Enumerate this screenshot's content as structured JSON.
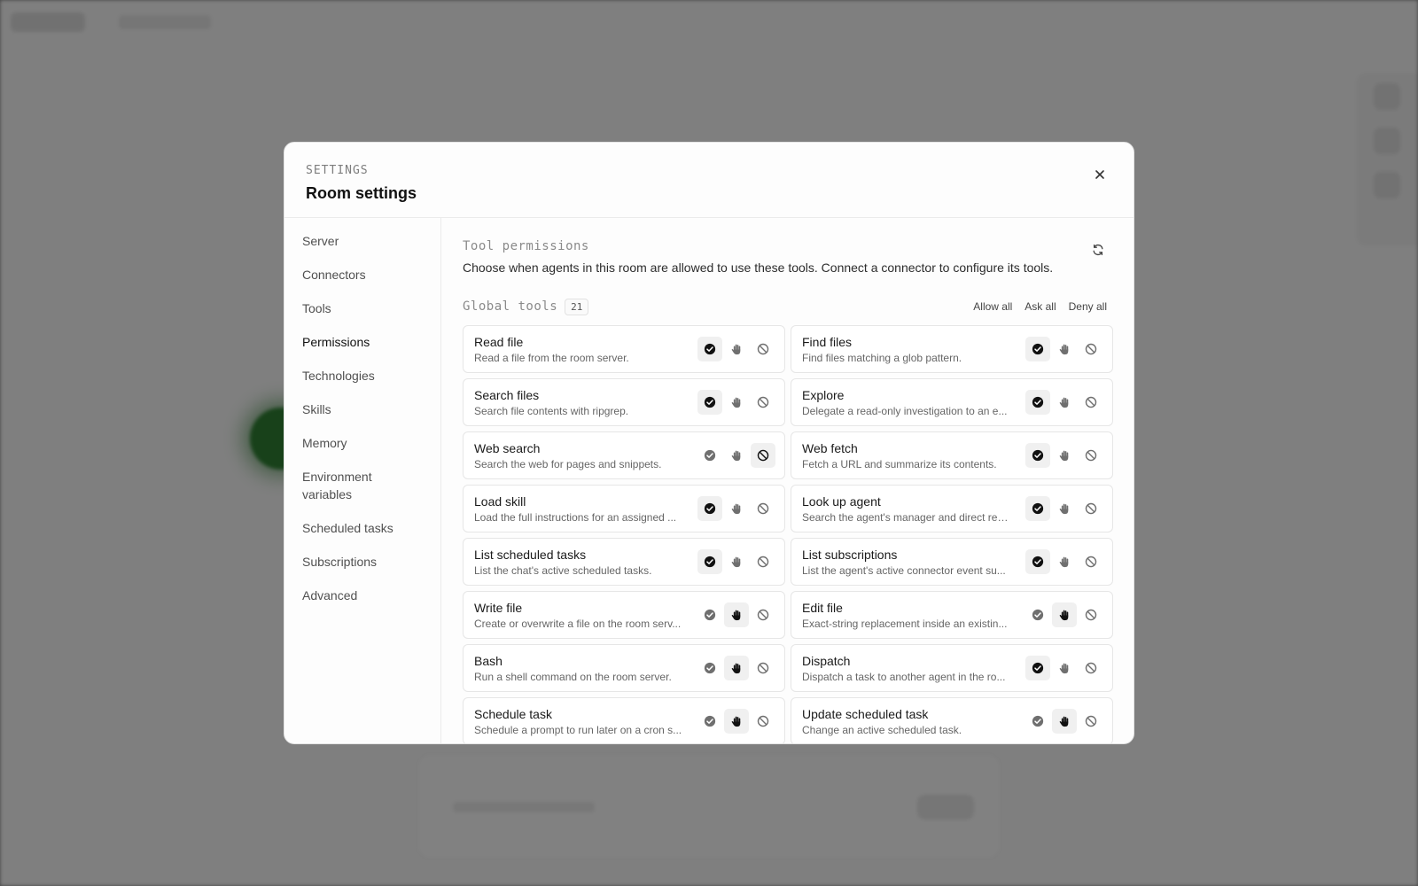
{
  "modal": {
    "eyebrow": "SETTINGS",
    "title": "Room settings",
    "close_icon": "close-icon"
  },
  "sidebar": {
    "items": [
      {
        "label": "Server",
        "active": false
      },
      {
        "label": "Connectors",
        "active": false
      },
      {
        "label": "Tools",
        "active": false
      },
      {
        "label": "Permissions",
        "active": true
      },
      {
        "label": "Technologies",
        "active": false
      },
      {
        "label": "Skills",
        "active": false
      },
      {
        "label": "Memory",
        "active": false
      },
      {
        "label": "Environment variables",
        "active": false
      },
      {
        "label": "Scheduled tasks",
        "active": false
      },
      {
        "label": "Subscriptions",
        "active": false
      },
      {
        "label": "Advanced",
        "active": false
      }
    ]
  },
  "section": {
    "title": "Tool permissions",
    "description": "Choose when agents in this room are allowed to use these tools. Connect a connector to configure its tools.",
    "refresh_icon": "refresh-icon"
  },
  "group": {
    "title": "Global tools",
    "count": "21",
    "allow_all": "Allow all",
    "ask_all": "Ask all",
    "deny_all": "Deny all"
  },
  "colors": {
    "selected_icon": "#111111",
    "muted_icon": "#6f6f6f",
    "selected_bg": "#f0f0f0"
  },
  "tools": [
    {
      "name": "Read file",
      "desc": "Read a file from the room server.",
      "mode": "allow"
    },
    {
      "name": "Find files",
      "desc": "Find files matching a glob pattern.",
      "mode": "allow"
    },
    {
      "name": "Search files",
      "desc": "Search file contents with ripgrep.",
      "mode": "allow"
    },
    {
      "name": "Explore",
      "desc": "Delegate a read-only investigation to an e...",
      "mode": "allow"
    },
    {
      "name": "Web search",
      "desc": "Search the web for pages and snippets.",
      "mode": "deny"
    },
    {
      "name": "Web fetch",
      "desc": "Fetch a URL and summarize its contents.",
      "mode": "allow"
    },
    {
      "name": "Load skill",
      "desc": "Load the full instructions for an assigned ...",
      "mode": "allow"
    },
    {
      "name": "Look up agent",
      "desc": "Search the agent's manager and direct rep...",
      "mode": "allow"
    },
    {
      "name": "List scheduled tasks",
      "desc": "List the chat's active scheduled tasks.",
      "mode": "allow"
    },
    {
      "name": "List subscriptions",
      "desc": "List the agent's active connector event su...",
      "mode": "allow"
    },
    {
      "name": "Write file",
      "desc": "Create or overwrite a file on the room serv...",
      "mode": "ask"
    },
    {
      "name": "Edit file",
      "desc": "Exact-string replacement inside an existin...",
      "mode": "ask"
    },
    {
      "name": "Bash",
      "desc": "Run a shell command on the room server.",
      "mode": "ask"
    },
    {
      "name": "Dispatch",
      "desc": "Dispatch a task to another agent in the ro...",
      "mode": "allow"
    },
    {
      "name": "Schedule task",
      "desc": "Schedule a prompt to run later on a cron s...",
      "mode": "ask"
    },
    {
      "name": "Update scheduled task",
      "desc": "Change an active scheduled task.",
      "mode": "ask"
    }
  ]
}
